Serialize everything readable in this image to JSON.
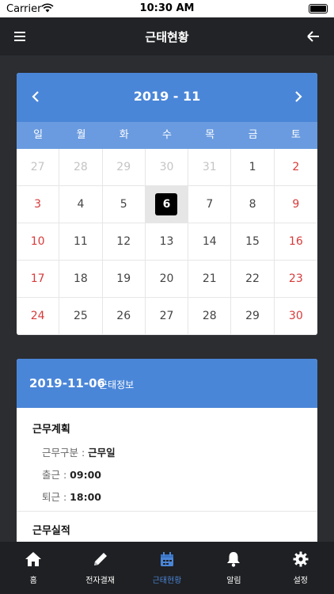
{
  "status": {
    "carrier": "Carrier",
    "time": "10:30 AM"
  },
  "header": {
    "title": "근태현황",
    "menu_icon": "menu-icon",
    "back_icon": "arrow-left-icon"
  },
  "calendar": {
    "month": "2019 - 11",
    "weekdays": [
      "일",
      "월",
      "화",
      "수",
      "목",
      "금",
      "토"
    ],
    "rows": [
      [
        "27",
        "28",
        "29",
        "30",
        "31",
        "1",
        "2"
      ],
      [
        "3",
        "4",
        "5",
        "6",
        "7",
        "8",
        "9"
      ],
      [
        "10",
        "11",
        "12",
        "13",
        "14",
        "15",
        "16"
      ],
      [
        "17",
        "18",
        "19",
        "20",
        "21",
        "22",
        "23"
      ],
      [
        "24",
        "25",
        "26",
        "27",
        "28",
        "29",
        "30"
      ]
    ],
    "selected": "6"
  },
  "info": {
    "date": "2019-11-06",
    "label": "근태정보",
    "plan_title": "근무계획",
    "work_type_label": "근무구분 : ",
    "work_type_value": "근무일",
    "checkin_label": "출근 : ",
    "checkin_value": "09:00",
    "checkout_label": "퇴근 : ",
    "checkout_value": "18:00",
    "actual_title": "근무실적"
  },
  "tabs": [
    {
      "label": "홈",
      "icon": "home-icon"
    },
    {
      "label": "전자결재",
      "icon": "pencil-icon"
    },
    {
      "label": "근태현황",
      "icon": "calendar-icon"
    },
    {
      "label": "알림",
      "icon": "bell-icon"
    },
    {
      "label": "설정",
      "icon": "gear-icon"
    }
  ],
  "colors": {
    "accent": "#4a86d8",
    "weekday_bar": "#6a9be0",
    "sunday_red": "#d73a3a",
    "bg": "#2b2d31"
  }
}
